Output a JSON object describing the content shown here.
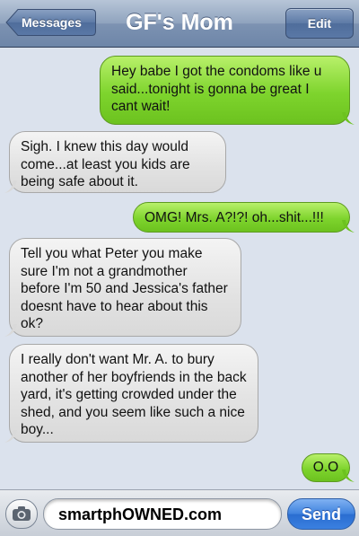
{
  "navbar": {
    "back_label": "Messages",
    "title": "GF's Mom",
    "edit_label": "Edit"
  },
  "messages": [
    {
      "direction": "outgoing",
      "text": "Hey babe I got the condoms like u said...tonight is gonna be great I cant wait!"
    },
    {
      "direction": "incoming",
      "text": "Sigh. I knew this day would come...at least you kids are being safe about it."
    },
    {
      "direction": "outgoing",
      "text": "OMG! Mrs. A?!?! oh...shit...!!!"
    },
    {
      "direction": "incoming",
      "text": "Tell you what Peter you make sure I'm not a grandmother before I'm 50 and Jessica's father doesnt have to hear about this ok?"
    },
    {
      "direction": "incoming",
      "text": "I really don't want Mr. A. to bury another of her boyfriends in the back yard, it's getting crowded under the shed, and you seem like such a nice boy..."
    },
    {
      "direction": "outgoing",
      "text": "O.O"
    }
  ],
  "composer": {
    "input_value": "smartphOWNED.com",
    "send_label": "Send",
    "camera_icon": "camera-icon"
  },
  "colors": {
    "outgoing_bubble": "#7ed42d",
    "incoming_bubble": "#e2e2e2",
    "navbar": "#7d93b2",
    "send_button": "#3f82de",
    "background": "#dbe2ed"
  }
}
